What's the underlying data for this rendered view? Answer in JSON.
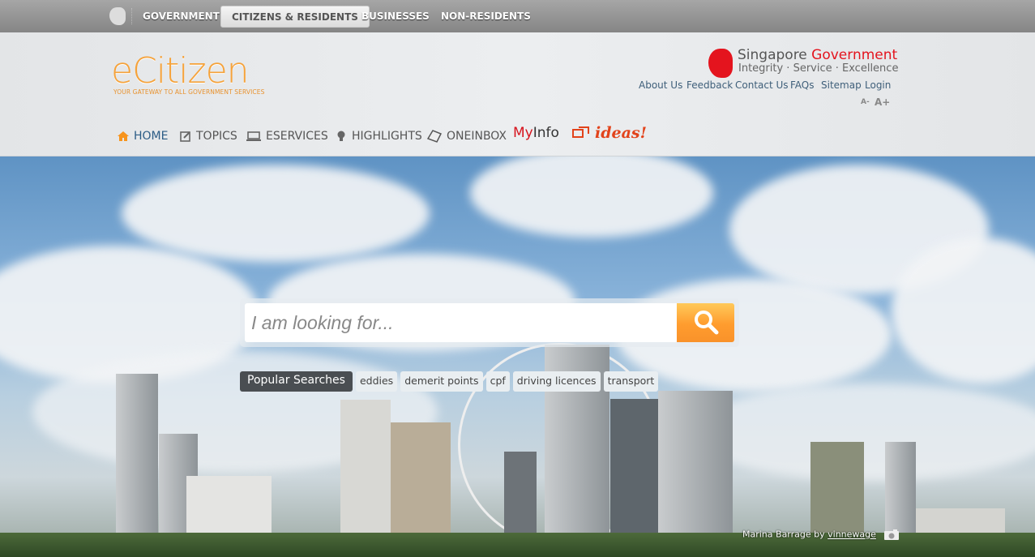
{
  "topnav": {
    "items": [
      {
        "label": "GOVERNMENT"
      },
      {
        "label": "CITIZENS & RESIDENTS",
        "active": true
      },
      {
        "label": "BUSINESSES"
      },
      {
        "label": "NON-RESIDENTS"
      }
    ]
  },
  "header": {
    "logo": "eCitizen",
    "tagline": "YOUR GATEWAY TO ALL GOVERNMENT SERVICES",
    "sg_name_1": "Singapore",
    "sg_name_2": "Government",
    "sg_motto": "Integrity · Service · Excellence",
    "utility_links": [
      "About Us",
      "Feedback",
      "Contact Us",
      "FAQs",
      "Sitemap",
      "Login"
    ],
    "font_smaller": "A-",
    "font_larger": "A+"
  },
  "mainnav": {
    "items": [
      {
        "label": "HOME",
        "icon": "home-icon"
      },
      {
        "label": "TOPICS",
        "icon": "edit-icon"
      },
      {
        "label": "ESERVICES",
        "icon": "laptop-icon"
      },
      {
        "label": "HIGHLIGHTS",
        "icon": "lightbulb-icon"
      },
      {
        "label": "ONEINBOX",
        "icon": "inbox-icon"
      }
    ],
    "myinfo_1": "My",
    "myinfo_2": "Info",
    "ideas": "ideas!"
  },
  "search": {
    "placeholder": "I am looking for..."
  },
  "popular": {
    "label": "Popular Searches",
    "tags": [
      "eddies",
      "demerit points",
      "cpf",
      "driving licences",
      "transport"
    ]
  },
  "credit": {
    "text": "Marina Barrage by ",
    "author": "vinnewage"
  },
  "colors": {
    "accent": "#f5a23a",
    "brand_red": "#e4141e",
    "link": "#3f5f7a"
  }
}
